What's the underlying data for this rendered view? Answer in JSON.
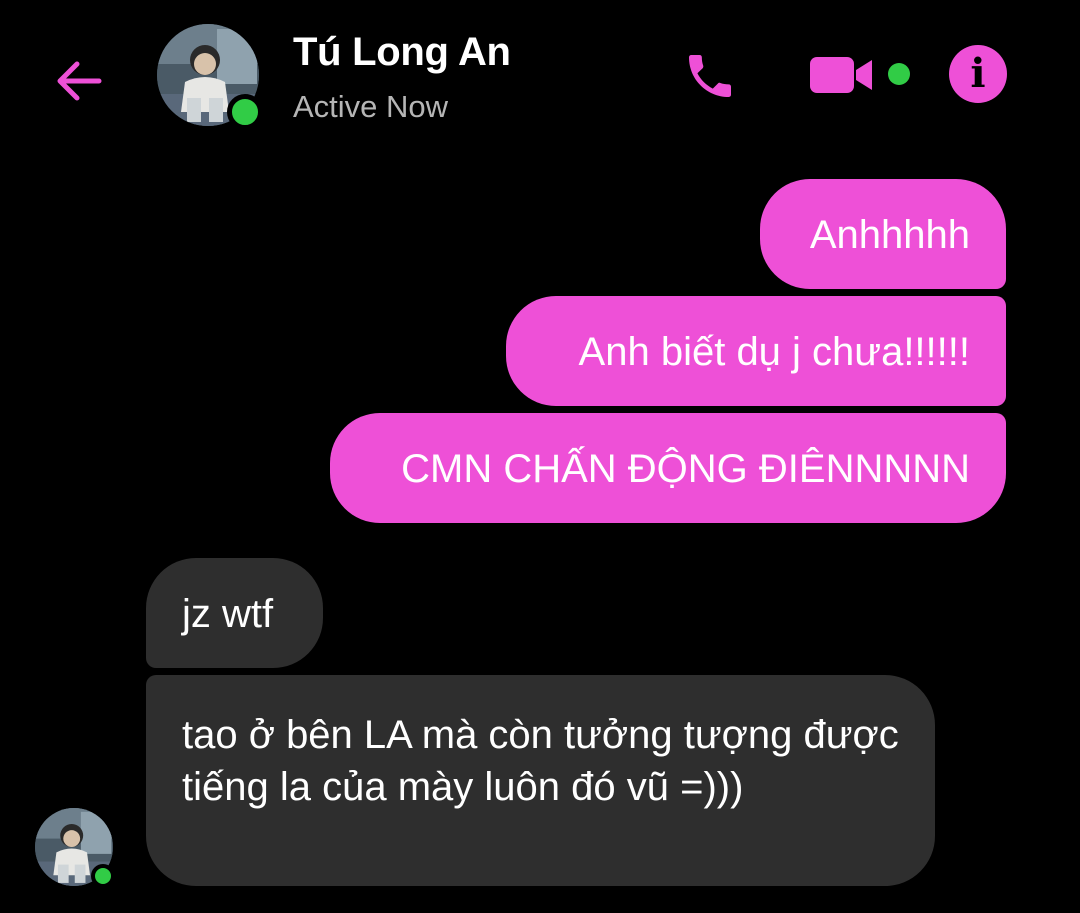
{
  "header": {
    "back_icon": "arrow-left-icon",
    "contact_name": "Tú Long An",
    "status": "Active Now",
    "call_icon": "phone-icon",
    "video_icon": "video-camera-icon",
    "info_icon": "info-icon",
    "info_glyph": "i"
  },
  "colors": {
    "accent": "#ee50d7",
    "incoming_bubble": "#2e2e2e",
    "presence": "#31cc46",
    "background": "#000000",
    "status_text": "#b5b5b5"
  },
  "messages": [
    {
      "direction": "outgoing",
      "text": "Anhhhhh"
    },
    {
      "direction": "outgoing",
      "text": "Anh biết dụ j chưa!!!!!!"
    },
    {
      "direction": "outgoing",
      "text": "CMN CHẤN ĐỘNG ĐIÊNNNNN"
    },
    {
      "direction": "incoming",
      "text": "jz wtf"
    },
    {
      "direction": "incoming",
      "text": "tao ở bên LA mà còn tưởng tượng được tiếng la của mày luôn đó vũ =)))"
    }
  ]
}
